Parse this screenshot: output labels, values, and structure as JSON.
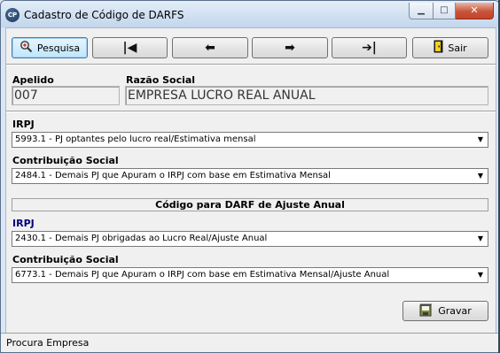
{
  "window": {
    "title": "Cadastro de Código de DARFS",
    "app_icon_text": "CP"
  },
  "toolbar": {
    "search_label": "Pesquisa",
    "exit_label": "Sair"
  },
  "company": {
    "apelido_label": "Apelido",
    "apelido_value": "007",
    "razao_label": "Razão Social",
    "razao_value": "EMPRESA LUCRO REAL ANUAL"
  },
  "monthly": {
    "irpj_label": "IRPJ",
    "irpj_value": "5993.1 - PJ optantes pelo lucro real/Estimativa mensal",
    "cs_label": "Contribuição Social",
    "cs_value": "2484.1 - Demais PJ que Apuram o IRPJ com base em Estimativa Mensal"
  },
  "annual": {
    "section_title": "Código para DARF de Ajuste Anual",
    "irpj_label": "IRPJ",
    "irpj_value": "2430.1 - Demais PJ obrigadas ao Lucro Real/Ajuste Anual",
    "cs_label": "Contribuição Social",
    "cs_value": "6773.1 - Demais PJ que Apuram o IRPJ com base em Estimativa Mensal/Ajuste Anual"
  },
  "actions": {
    "save_label": "Gravar"
  },
  "status": {
    "text": "Procura Empresa"
  },
  "icons": {
    "app": "cp-app-icon",
    "search": "magnifier-icon",
    "first": "first-record-icon",
    "prev": "arrow-left-icon",
    "next": "arrow-right-icon",
    "last": "last-record-icon",
    "exit": "exit-door-icon",
    "save": "save-disk-icon"
  },
  "colors": {
    "annual_irpj_label": "#000080",
    "focus_button": "#bee6fd"
  }
}
